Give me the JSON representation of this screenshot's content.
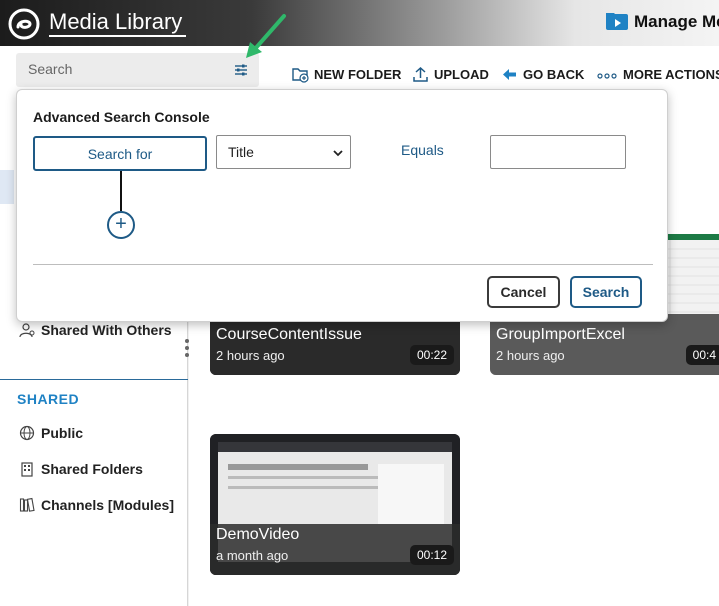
{
  "header": {
    "app_title": "Media Library",
    "manage_label": "Manage Me"
  },
  "toolbar": {
    "search_placeholder": "Search",
    "new_folder": "NEW FOLDER",
    "upload": "UPLOAD",
    "go_back": "GO BACK",
    "more_actions": "MORE ACTIONS"
  },
  "sidebar": {
    "shared_with_others": "Shared With Others",
    "shared_header": "SHARED",
    "items": [
      {
        "label": "Public",
        "icon": "globe-icon"
      },
      {
        "label": "Shared Folders",
        "icon": "building-icon"
      },
      {
        "label": "Channels [Modules]",
        "icon": "library-icon"
      }
    ]
  },
  "media": [
    {
      "title": "CourseContentIssue",
      "age": "2 hours ago",
      "duration": "00:22"
    },
    {
      "title": "GroupImportExcel",
      "age": "2 hours ago",
      "duration": "00:4"
    },
    {
      "title": "DemoVideo",
      "age": "a month ago",
      "duration": "00:12"
    }
  ],
  "advanced_search": {
    "title": "Advanced Search Console",
    "search_for": "Search for",
    "field_selected": "Title",
    "operator": "Equals",
    "value": "",
    "cancel": "Cancel",
    "search": "Search"
  },
  "colors": {
    "accent": "#1e5a86",
    "shared_header": "#1f82c4",
    "annotation_arrow": "#2fb86a"
  }
}
